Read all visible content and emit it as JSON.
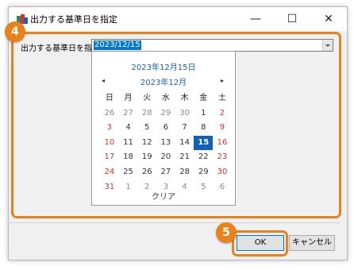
{
  "window": {
    "title": "出力する基準日を指定",
    "minimize_glyph": "—",
    "maximize_glyph": "☐",
    "close_glyph": "✕"
  },
  "annotations": {
    "highlight_color": "#e8821c",
    "badge_4": "4",
    "badge_5": "5"
  },
  "form": {
    "label": "出力する基準日を指定",
    "date_value": "2023/12/15"
  },
  "calendar": {
    "today_label": "2023年12月15日",
    "month_label": "2023年12月",
    "prev_glyph": "◂",
    "next_glyph": "▸",
    "weekdays": [
      "日",
      "月",
      "火",
      "水",
      "木",
      "金",
      "土"
    ],
    "weeks": [
      [
        "26",
        "27",
        "28",
        "29",
        "30",
        "1",
        "2"
      ],
      [
        "3",
        "4",
        "5",
        "6",
        "7",
        "8",
        "9"
      ],
      [
        "10",
        "11",
        "12",
        "13",
        "14",
        "15",
        "16"
      ],
      [
        "17",
        "18",
        "19",
        "20",
        "21",
        "22",
        "23"
      ],
      [
        "24",
        "25",
        "26",
        "27",
        "28",
        "29",
        "30"
      ],
      [
        "31",
        "1",
        "2",
        "3",
        "4",
        "5",
        "6"
      ]
    ],
    "selected_day": "15",
    "clear_label": "クリア",
    "selected_color": "#1261b8",
    "weekend_color": "#d9302c"
  },
  "buttons": {
    "ok_label": "OK",
    "cancel_label": "キャンセル"
  }
}
